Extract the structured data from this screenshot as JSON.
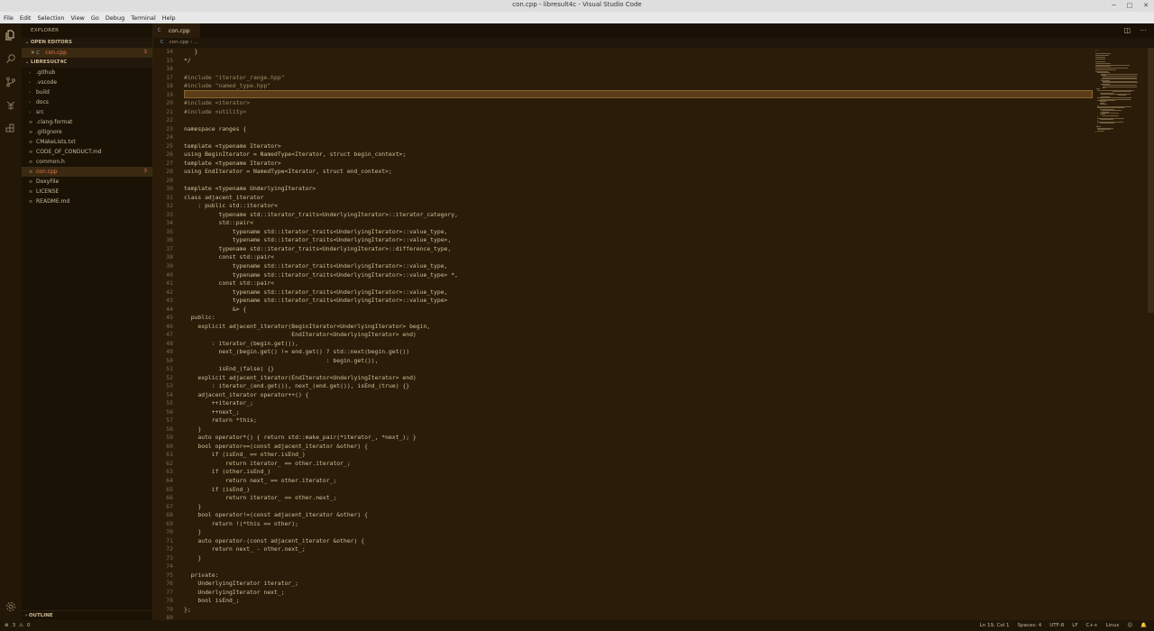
{
  "window": {
    "title": "con.cpp - libresult4c - Visual Studio Code"
  },
  "menu": [
    "File",
    "Edit",
    "Selection",
    "View",
    "Go",
    "Debug",
    "Terminal",
    "Help"
  ],
  "activity_icons": [
    "files-icon",
    "search-icon",
    "source-control-icon",
    "debug-icon",
    "extensions-icon"
  ],
  "sidebar": {
    "header": "EXPLORER",
    "open_editors_label": "OPEN EDITORS",
    "open_editor": {
      "name": "con.cpp",
      "badge": "3"
    },
    "project_label": "LIBRESULT4C",
    "items": [
      {
        "name": ".github",
        "type": "folder"
      },
      {
        "name": ".vscode",
        "type": "folder"
      },
      {
        "name": "build",
        "type": "folder"
      },
      {
        "name": "docs",
        "type": "folder"
      },
      {
        "name": "src",
        "type": "folder"
      },
      {
        "name": ".clang-format",
        "type": "file"
      },
      {
        "name": ".gitignore",
        "type": "file"
      },
      {
        "name": "CMakeLists.txt",
        "type": "file"
      },
      {
        "name": "CODE_OF_CONDUCT.md",
        "type": "file"
      },
      {
        "name": "common.h",
        "type": "file"
      },
      {
        "name": "con.cpp",
        "type": "file",
        "selected": true,
        "badge": "3"
      },
      {
        "name": "DoxyFile",
        "type": "file"
      },
      {
        "name": "LICENSE",
        "type": "file"
      },
      {
        "name": "README.md",
        "type": "file"
      }
    ],
    "outline_label": "OUTLINE"
  },
  "tab": {
    "label": "con.cpp"
  },
  "breadcrumb": {
    "file": "con.cpp",
    "rest": "..."
  },
  "editor": {
    "first_line": 14,
    "current_line": 19,
    "lines": [
      "   }",
      "*/",
      "",
      "#include \"iterator_range.hpp\"",
      "#include \"named_type.hpp\"",
      "",
      "#include <iterator>",
      "#include <utility>",
      "",
      "namespace ranges {",
      "",
      "template <typename Iterator>",
      "using BeginIterator = NamedType<Iterator, struct begin_context>;",
      "template <typename Iterator>",
      "using EndIterator = NamedType<Iterator, struct end_context>;",
      "",
      "template <typename UnderlyingIterator>",
      "class adjacent_iterator",
      "    : public std::iterator<",
      "          typename std::iterator_traits<UnderlyingIterator>::iterator_category,",
      "          std::pair<",
      "              typename std::iterator_traits<UnderlyingIterator>::value_type,",
      "              typename std::iterator_traits<UnderlyingIterator>::value_type>,",
      "          typename std::iterator_traits<UnderlyingIterator>::difference_type,",
      "          const std::pair<",
      "              typename std::iterator_traits<UnderlyingIterator>::value_type,",
      "              typename std::iterator_traits<UnderlyingIterator>::value_type> *,",
      "          const std::pair<",
      "              typename std::iterator_traits<UnderlyingIterator>::value_type,",
      "              typename std::iterator_traits<UnderlyingIterator>::value_type>",
      "              &> {",
      "  public:",
      "    explicit adjacent_iterator(BeginIterator<UnderlyingIterator> begin,",
      "                               EndIterator<UnderlyingIterator> end)",
      "        : iterator_(begin.get()),",
      "          next_(begin.get() != end.get() ? std::next(begin.get())",
      "                                         : begin.get()),",
      "          isEnd_(false) {}",
      "    explicit adjacent_iterator(EndIterator<UnderlyingIterator> end)",
      "        : iterator_(end.get()), next_(end.get()), isEnd_(true) {}",
      "    adjacent_iterator operator++() {",
      "        ++iterator_;",
      "        ++next_;",
      "        return *this;",
      "    }",
      "    auto operator*() { return std::make_pair(*iterator_, *next_); }",
      "    bool operator==(const adjacent_iterator &other) {",
      "        if (isEnd_ == other.isEnd_)",
      "            return iterator_ == other.iterator_;",
      "        if (other.isEnd_)",
      "            return next_ == other.iterator_;",
      "        if (isEnd_)",
      "            return iterator_ == other.next_;",
      "    }",
      "    bool operator!=(const adjacent_iterator &other) {",
      "        return !(*this == other);",
      "    }",
      "    auto operator-(const adjacent_iterator &other) {",
      "        return next_ - other.next_;",
      "    }",
      "",
      "  private:",
      "    UnderlyingIterator iterator_;",
      "    UnderlyingIterator next_;",
      "    bool isEnd_;",
      "};",
      ""
    ]
  },
  "status": {
    "errors": "3",
    "warnings": "0",
    "position": "Ln 19, Col 1",
    "spaces": "Spaces: 4",
    "encoding": "UTF-8",
    "eol": "LF",
    "language": "C++",
    "os": "Linux"
  },
  "colors": {
    "accent": "#e07a4a",
    "editor_bg": "#2a1c09",
    "sidebar_bg": "#1b1206"
  }
}
